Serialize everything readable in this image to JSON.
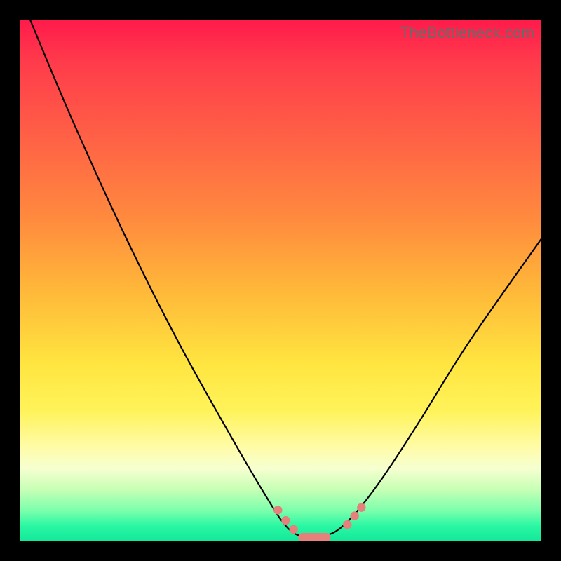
{
  "watermark": "TheBottleneck.com",
  "chart_data": {
    "type": "line",
    "title": "",
    "xlabel": "",
    "ylabel": "",
    "xlim": [
      0,
      100
    ],
    "ylim": [
      0,
      100
    ],
    "grid": false,
    "legend": false,
    "curve_points": [
      {
        "x": 2,
        "y": 100
      },
      {
        "x": 10,
        "y": 81
      },
      {
        "x": 20,
        "y": 59
      },
      {
        "x": 30,
        "y": 39
      },
      {
        "x": 40,
        "y": 21
      },
      {
        "x": 47,
        "y": 9
      },
      {
        "x": 51,
        "y": 3
      },
      {
        "x": 54,
        "y": 1
      },
      {
        "x": 58,
        "y": 1
      },
      {
        "x": 62,
        "y": 3
      },
      {
        "x": 68,
        "y": 10
      },
      {
        "x": 76,
        "y": 22
      },
      {
        "x": 86,
        "y": 38
      },
      {
        "x": 100,
        "y": 58
      }
    ],
    "marked_points": [
      {
        "x": 49.5,
        "y": 6.0
      },
      {
        "x": 51.0,
        "y": 4.0
      },
      {
        "x": 52.5,
        "y": 2.3
      },
      {
        "x": 62.8,
        "y": 3.2
      },
      {
        "x": 64.2,
        "y": 4.9
      },
      {
        "x": 65.5,
        "y": 6.5
      }
    ],
    "flat_segment": {
      "x0": 54.2,
      "x1": 58.8,
      "y": 0.8
    },
    "colors": {
      "gradient_top": "#ff1a4b",
      "gradient_bottom": "#12e89a",
      "curve": "#000000",
      "marker": "#e5807b",
      "frame": "#000000"
    }
  }
}
